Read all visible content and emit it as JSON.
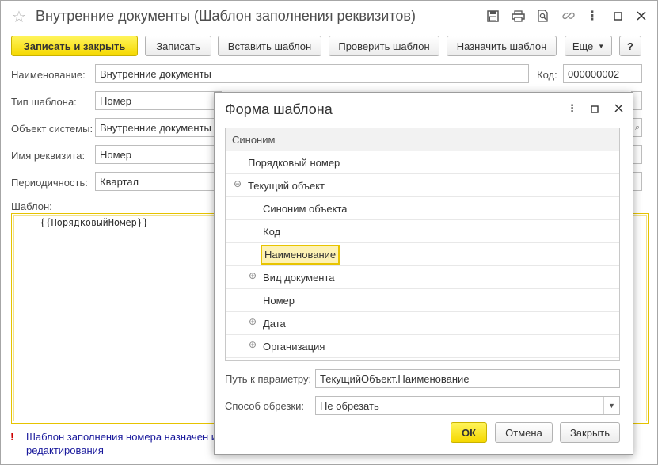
{
  "window": {
    "title": "Внутренние документы (Шаблон заполнения реквизитов)"
  },
  "icons": {
    "favorite": "star-icon",
    "save": "floppy-icon",
    "print": "printer-icon",
    "preview": "search-document-icon",
    "link": "link-icon",
    "more": "vertical-dots-icon",
    "maximize": "maximize-icon",
    "close": "close-icon"
  },
  "toolbar": {
    "save_close": "Записать и закрыть",
    "save": "Записать",
    "insert_template": "Вставить шаблон",
    "check_template": "Проверить шаблон",
    "assign_template": "Назначить шаблон",
    "more": "Еще",
    "help": "?"
  },
  "form": {
    "name_label": "Наименование:",
    "name_value": "Внутренние документы",
    "code_label": "Код:",
    "code_value": "000000002",
    "type_label": "Тип шаблона:",
    "type_value": "Номер",
    "object_label": "Объект системы:",
    "object_value": "Внутренние документы",
    "attr_label": "Имя реквизита:",
    "attr_value": "Номер",
    "period_label": "Периодичность:",
    "period_value": "Квартал",
    "template_label": "Шаблон:",
    "template_text": "{{ПорядковыйНомер}}",
    "warning_line1": "Шаблон заполнения номера назначен и",
    "warning_line2": "редактирования"
  },
  "dialog": {
    "title": "Форма шаблона",
    "column_header": "Синоним",
    "rows": [
      {
        "label": "Порядковый номер",
        "expander": ""
      },
      {
        "label": "Текущий объект",
        "expander": "⊖"
      },
      {
        "label": "Синоним объекта",
        "expander": ""
      },
      {
        "label": "Код",
        "expander": ""
      },
      {
        "label": "Наименование",
        "expander": ""
      },
      {
        "label": "Вид документа",
        "expander": "⊕"
      },
      {
        "label": "Номер",
        "expander": ""
      },
      {
        "label": "Дата",
        "expander": "⊕"
      },
      {
        "label": "Организация",
        "expander": "⊕"
      }
    ],
    "selected_row": "Наименование",
    "path_label": "Путь к параметру:",
    "path_value": "ТекущийОбъект.Наименование",
    "trim_label": "Способ обрезки:",
    "trim_value": "Не обрезать",
    "ok": "ОК",
    "cancel": "Отмена",
    "close": "Закрыть"
  },
  "colors": {
    "accent_yellow": "#f5d800",
    "selection_fill": "#fdf2b4",
    "warning_text": "#1a1a9c",
    "warning_icon": "#cc0000"
  }
}
